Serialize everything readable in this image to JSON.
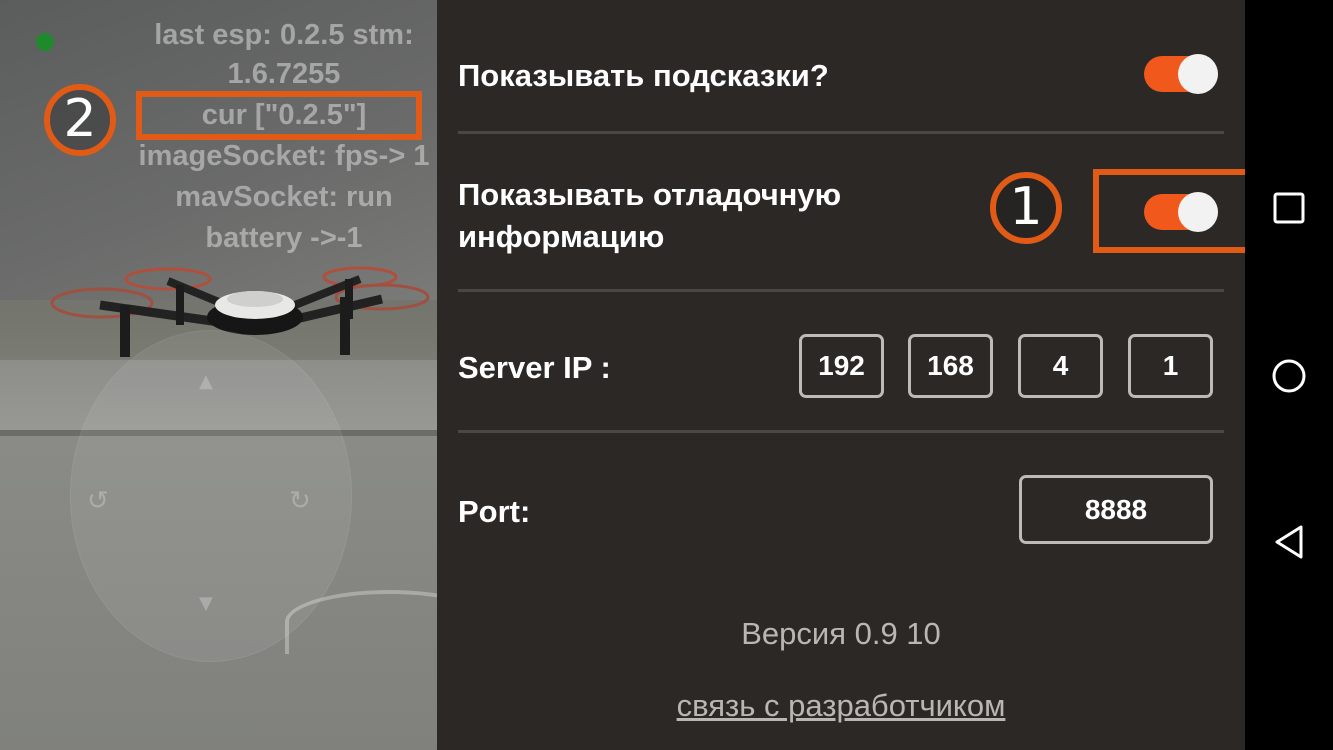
{
  "debug_overlay": {
    "lines": [
      "last esp: 0.2.5 stm:",
      "1.6.7255",
      "cur [\"0.2.5\"]",
      "imageSocket: fps-> 1",
      "mavSocket: run",
      "battery ->-1"
    ],
    "status_dot_color": "#1e8a2c"
  },
  "annotations": {
    "marker_1": "1",
    "marker_2": "2",
    "color": "#e15b17"
  },
  "settings": {
    "show_hints": {
      "label": "Показывать подсказки?",
      "enabled": true
    },
    "show_debug": {
      "label_line1": "Показывать отладочную",
      "label_line2": "информацию",
      "enabled": true
    },
    "server_ip": {
      "label": "Server IP :",
      "octets": [
        "192",
        "168",
        "4",
        "1"
      ]
    },
    "port": {
      "label": "Port:",
      "value": "8888"
    },
    "version_text": "Версия 0.9 10",
    "developer_link": "связь с разработчиком"
  },
  "colors": {
    "panel_bg": "#2b2826",
    "toggle_on": "#f0581c",
    "navbar_bg": "#000000"
  },
  "navbar": {
    "icons": [
      "recents-icon",
      "home-icon",
      "back-icon"
    ]
  }
}
